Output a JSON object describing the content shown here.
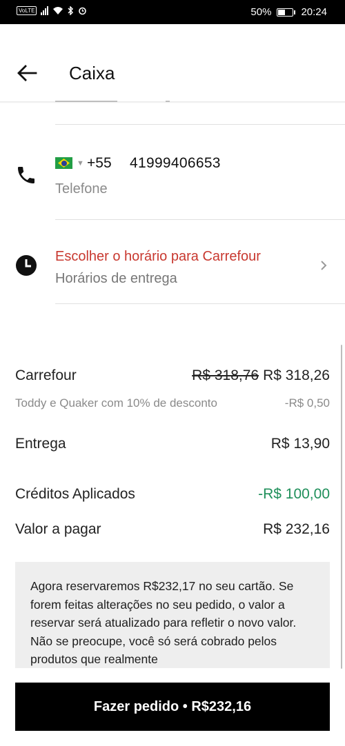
{
  "status_bar": {
    "volte": "VoLTE",
    "battery_percent": "50%",
    "time": "20:24"
  },
  "header": {
    "title": "Caixa"
  },
  "phone": {
    "country_code": "+55",
    "number": "41999406653",
    "label": "Telefone"
  },
  "schedule": {
    "title": "Escolher o horário para Carrefour",
    "subtitle": "Horários de entrega"
  },
  "summary": {
    "store_label": "Carrefour",
    "store_original_price": "R$ 318,76",
    "store_price": "R$ 318,26",
    "discount_label": "Toddy e Quaker com 10% de desconto",
    "discount_value": "-R$ 0,50",
    "delivery_label": "Entrega",
    "delivery_value": "R$ 13,90",
    "credits_label": "Créditos Aplicados",
    "credits_value": "-R$ 100,00",
    "total_label": "Valor a pagar",
    "total_value": "R$ 232,16"
  },
  "note": {
    "text": "Agora reservaremos R$232,17 no seu cartão. Se forem feitas alterações no seu pedido, o valor a reservar será atualizado para refletir o novo valor. Não se preocupe, você só será cobrado pelos produtos que realmente"
  },
  "cta": {
    "label": "Fazer pedido • R$232,16"
  },
  "colors": {
    "accent_red": "#c8382f",
    "credit_green": "#1f8f5a",
    "cta_background": "#000000"
  }
}
